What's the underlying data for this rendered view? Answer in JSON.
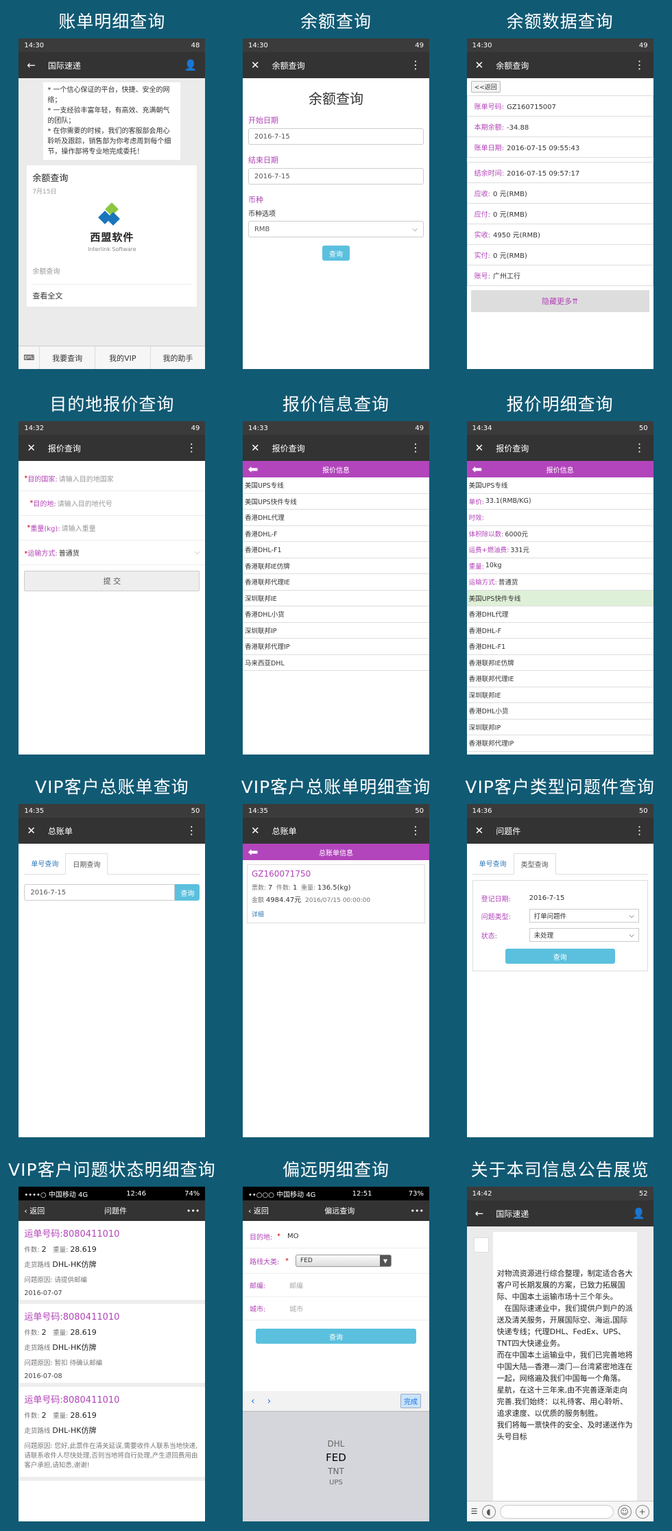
{
  "titles": [
    "账单明细查询",
    "余额查询",
    "余额数据查询",
    "目的地报价查询",
    "报价信息查询",
    "报价明细查询",
    "VIP客户总账单查询",
    "VIP客户总账单明细查询",
    "VIP客户类型问题件查询",
    "VIP客户问题状态明细查询",
    "偏远明细查询",
    "关于本司信息公告展览"
  ],
  "s1": {
    "time": "14:30",
    "battery": "48",
    "title": "国际速递",
    "bubble": "* 一个信心保证的平台，快捷、安全的网络；\n* 一支经验丰富年轻，有高效、充满朝气的团队；\n* 在你需要的时候，我们的客服部会用心聆听及跟踪，销售部为你考虑周到每个细节，操作部将专业地完成委托！",
    "card_title": "余额查询",
    "card_date": "7月15日",
    "logo_cn": "西盟软件",
    "logo_en": "Interlink Software",
    "card_sub": "余额查询",
    "read_all": "查看全文",
    "menu": [
      "我要查询",
      "我的VIP",
      "我的助手"
    ]
  },
  "s2": {
    "time": "14:30",
    "battery": "49",
    "title": "余额查询",
    "heading": "余额查询",
    "start_label": "开始日期",
    "start_val": "2016-7-15",
    "end_label": "结束日期",
    "end_val": "2016-7-15",
    "cur_label": "币种",
    "cur_sub": "币种选项",
    "cur_val": "RMB",
    "btn": "查询"
  },
  "s3": {
    "time": "14:30",
    "battery": "49",
    "title": "余额查询",
    "back": "<<返回",
    "rows1": [
      {
        "k": "账单号码:",
        "v": "GZ160715007"
      },
      {
        "k": "本期余额:",
        "v": "-34.88"
      },
      {
        "k": "账单日期:",
        "v": "2016-07-15 09:55:43"
      }
    ],
    "rows2": [
      {
        "k": "结余时间:",
        "v": "2016-07-15 09:57:17"
      },
      {
        "k": "应收:",
        "v": "0 元(RMB)"
      },
      {
        "k": "应付:",
        "v": "0 元(RMB)"
      },
      {
        "k": "实收:",
        "v": "4950 元(RMB)"
      },
      {
        "k": "实付:",
        "v": "0 元(RMB)"
      },
      {
        "k": "账号:",
        "v": "广州工行"
      }
    ],
    "more": "隐藏更多⇈"
  },
  "s4": {
    "time": "14:32",
    "battery": "49",
    "title": "报价查询",
    "rows": [
      {
        "k": "目的国家:",
        "ph": "请输入目的地国家"
      },
      {
        "k": "目的地:",
        "ph": "请输入目的地代号"
      },
      {
        "k": "重量(kg):",
        "ph": "请输入重量"
      }
    ],
    "ship_k": "运输方式:",
    "ship_v": "普通货",
    "submit": "提 交"
  },
  "s5": {
    "time": "14:33",
    "battery": "49",
    "title": "报价查询",
    "bar": "报价信息",
    "items": [
      "美国UPS专线",
      "美国UPS快件专线",
      "香港DHL代理",
      "香港DHL-F",
      "香港DHL-F1",
      "香港联邦IE仿牌",
      "香港联邦代理IE",
      "深圳联邦IE",
      "香港DHL小货",
      "深圳联邦IP",
      "香港联邦代理IP",
      "马来西亚DHL"
    ]
  },
  "s6": {
    "time": "14:34",
    "battery": "50",
    "title": "报价查询",
    "bar": "报价信息",
    "head": [
      {
        "k": "",
        "v": "美国UPS专线"
      },
      {
        "k": "单价:",
        "v": "33.1(RMB/KG)"
      },
      {
        "k": "时效:",
        "v": ""
      },
      {
        "k": "体积除以数:",
        "v": "6000元"
      },
      {
        "k": "运费+燃油费:",
        "v": "331元"
      },
      {
        "k": "重量:",
        "v": "10kg"
      },
      {
        "k": "运输方式:",
        "v": "普通货"
      }
    ],
    "items": [
      "美国UPS快件专线",
      "香港DHL代理",
      "香港DHL-F",
      "香港DHL-F1",
      "香港联邦IE仿牌",
      "香港联邦代理IE",
      "深圳联邦IE",
      "香港DHL小货",
      "深圳联邦IP",
      "香港联邦代理IP",
      "马来西亚DHL"
    ]
  },
  "s7": {
    "time": "14:35",
    "battery": "50",
    "title": "总账单",
    "tab1": "单号查询",
    "tab2": "日期查询",
    "date": "2016-7-15",
    "btn": "查询"
  },
  "s8": {
    "time": "14:35",
    "battery": "50",
    "title": "总账单",
    "bar": "总账单信息",
    "no": "GZ160071750",
    "l1a": "票数:",
    "l1b": "7",
    "l1c": "件数:",
    "l1d": "1",
    "l1e": "重量:",
    "l1f": "136.5(kg)",
    "l2a": "金额",
    "l2b": "4984.47元",
    "l2c": "2016/07/15 00:00:00",
    "detail": "详细"
  },
  "s9": {
    "time": "14:36",
    "battery": "50",
    "title": "问题件",
    "tab1": "单号查询",
    "tab2": "类型查询",
    "rows": [
      {
        "k": "登记日期:",
        "v": "2016-7-15"
      },
      {
        "k": "问题类型:",
        "v": "打单问题件"
      },
      {
        "k": "状态:",
        "v": "未处理"
      }
    ],
    "btn": "查询"
  },
  "s10": {
    "carrier": "••••○ 中国移动  4G",
    "time": "12:46",
    "battery": "74%",
    "back": "返回",
    "title": "问题件",
    "items": [
      {
        "no": "运单号码:8080411010",
        "pcs_k": "件数:",
        "pcs": "2",
        "wt_k": "重量:",
        "wt": "28.619",
        "route_k": "走货路线",
        "route": "DHL-HK仿牌",
        "reason": "问题原因: 请提供邮编",
        "date": "2016-07-07"
      },
      {
        "no": "运单号码:8080411010",
        "pcs_k": "件数:",
        "pcs": "2",
        "wt_k": "重量:",
        "wt": "28.619",
        "route_k": "走货路线",
        "route": "DHL-HK仿牌",
        "reason": "问题原因: 暂扣 待确认邮编",
        "date": "2016-07-08"
      },
      {
        "no": "运单号码:8080411010",
        "pcs_k": "件数:",
        "pcs": "2",
        "wt_k": "重量:",
        "wt": "28.619",
        "route_k": "走货路线",
        "route": "DHL-HK仿牌",
        "reason": "问题原因: 您好,此票件在清关延误,需要收件人联系当地快递,请联系收件人尽快处理,否则当地将自行处理,产生退回费用由客户承担,请知悉,谢谢!",
        "date": ""
      }
    ]
  },
  "s11": {
    "carrier": "••○○○ 中国移动 4G",
    "time": "12:51",
    "battery": "73%",
    "back": "返回",
    "title": "偏远查询",
    "dest_k": "目的地:",
    "dest_v": "MO",
    "route_k": "路线大类:",
    "route_v": "FED",
    "zip_k": "邮编:",
    "zip_ph": "邮编",
    "city_k": "城市:",
    "city_ph": "城市",
    "btn": "查询",
    "done": "完成",
    "opts": [
      "DHL",
      "FED",
      "TNT",
      "UPS"
    ]
  },
  "s12": {
    "time": "14:42",
    "battery": "52",
    "title": "国际速递",
    "text": "对物流资源进行综合整理，制定适合各大客户可长期发展的方案，已致力拓展国际、中国本土运输市场十三个年头。\n　在国际速递业中，我们提供户到户的派送及清关服务，开展国际空、海运,国际快递专线；代理DHL、FedEx、UPS、TNT四大快递业务。\n而在中国本土运输业中，我们已完善地将中国大陆—香港—澳门—台湾紧密地连在一起，网络遍及我们中国每一个角落。\n星航，在这十三年来,由不完善逐渐走向完善.我们始终：以礼待客、用心聆听、追求速度、以优质的服务制胜。\n我们将每一票快件的安全、及时递送作为头号目标"
  }
}
